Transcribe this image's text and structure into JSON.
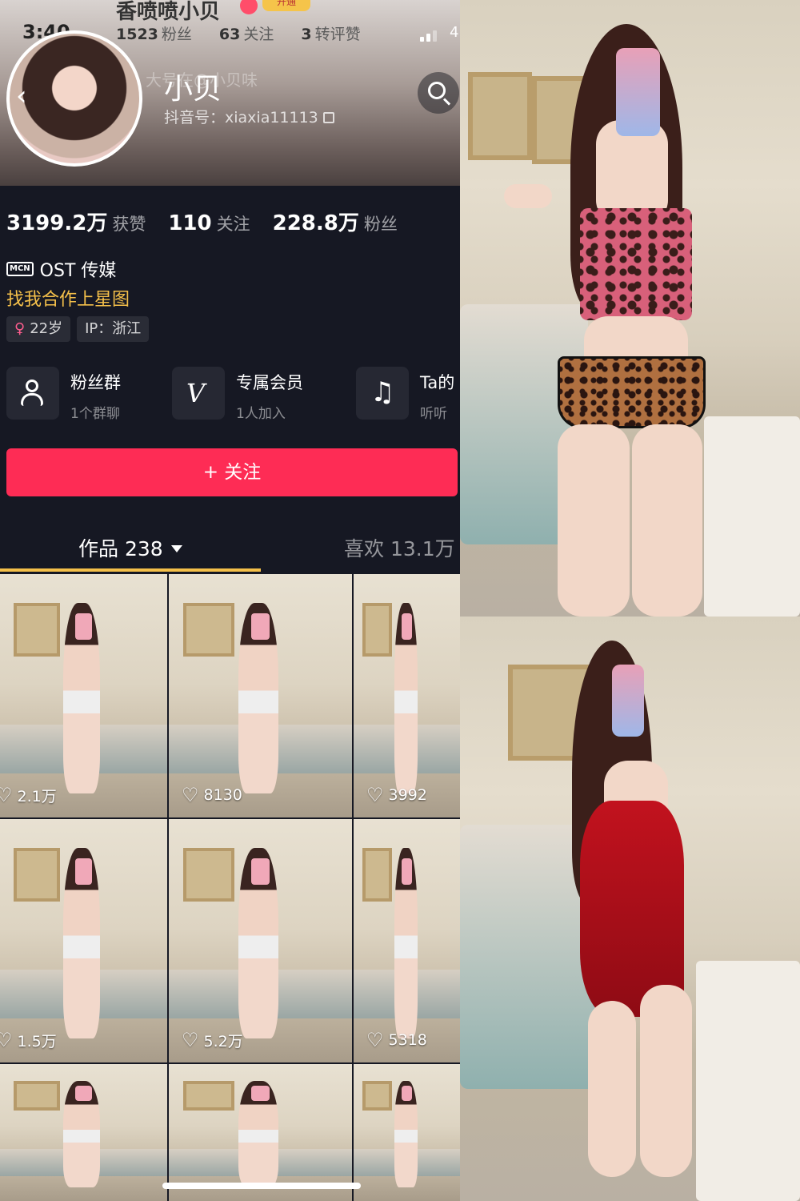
{
  "status_bar": {
    "time": "3:40",
    "battery_fragment": "4"
  },
  "ghost_header": {
    "name": "香喷喷小贝",
    "badge": "开通",
    "stats": [
      {
        "value": "1523",
        "label": "粉丝"
      },
      {
        "value": "63",
        "label": "关注"
      },
      {
        "value": "3",
        "label": "转评赞"
      }
    ],
    "subtitle": "大号在@小贝味"
  },
  "profile": {
    "name": "小贝",
    "douyin_id": "抖音号：xiaxia11113",
    "stats": [
      {
        "value": "3199.2万",
        "label": "获赞"
      },
      {
        "value": "110",
        "label": "关注"
      },
      {
        "value": "228.8万",
        "label": "粉丝"
      }
    ],
    "mcn_badge": "MCN",
    "mcn": "OST 传媒",
    "collab_link": "找我合作上星图",
    "tags": {
      "age": "22岁",
      "ip": "IP：浙江"
    }
  },
  "features": [
    {
      "title": "粉丝群",
      "subtitle": "1个群聊",
      "icon": "fan-group-icon"
    },
    {
      "title": "专属会员",
      "subtitle": "1人加入",
      "icon": "vip-icon"
    },
    {
      "title": "Ta的",
      "subtitle": "听听",
      "icon": "music-note-icon"
    }
  ],
  "follow_button": "+ 关注",
  "tabs": {
    "works": "作品 238",
    "likes": "喜欢 13.1万"
  },
  "videos": [
    {
      "likes": "2.1万"
    },
    {
      "likes": "8130"
    },
    {
      "likes": "3992"
    },
    {
      "likes": "1.5万"
    },
    {
      "likes": "5.2万"
    },
    {
      "likes": "5318"
    },
    {
      "likes": ""
    },
    {
      "likes": ""
    },
    {
      "likes": ""
    }
  ],
  "colors": {
    "background": "#161823",
    "follow_button": "#fe2c55",
    "accent": "#f5c04a"
  }
}
